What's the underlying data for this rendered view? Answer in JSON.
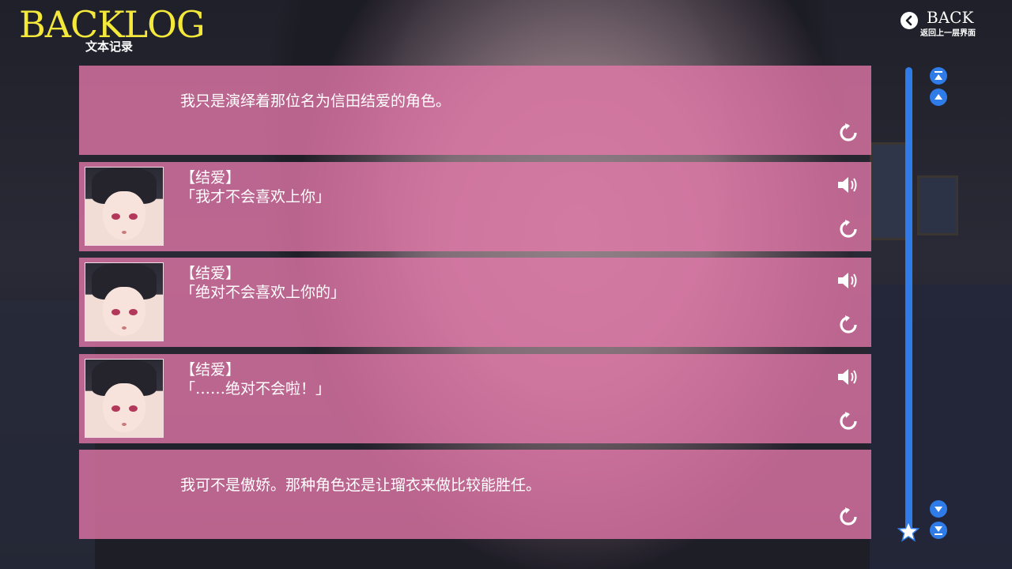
{
  "header": {
    "title": "BACKLOG",
    "subtitle": "文本记录",
    "back_label": "BACK",
    "back_sub": "返回上一层界面"
  },
  "colors": {
    "title": "#f4e93a",
    "entry_bg": "#e678aa",
    "scrollbar": "#2f7be8"
  },
  "entries": [
    {
      "type": "narration",
      "text": "我只是演绎着那位名为信田结爱的角色。",
      "has_voice": false
    },
    {
      "type": "dialogue",
      "speaker": "【结爱】",
      "text": "「我才不会喜欢上你」",
      "has_voice": true,
      "expression": "surprised"
    },
    {
      "type": "dialogue",
      "speaker": "【结爱】",
      "text": "「绝对不会喜欢上你的」",
      "has_voice": true,
      "expression": "calm"
    },
    {
      "type": "dialogue",
      "speaker": "【结爱】",
      "text": "「……绝对不会啦！」",
      "has_voice": true,
      "expression": "flustered"
    },
    {
      "type": "narration",
      "text": "我可不是傲娇。那种角色还是让瑠衣来做比较能胜任。",
      "has_voice": false
    }
  ],
  "icons": {
    "back": "chevron-left-circle-icon",
    "voice": "speaker-icon",
    "replay": "replay-icon",
    "scroll_top": "double-chevron-up-icon",
    "scroll_up": "chevron-up-icon",
    "scroll_down": "chevron-down-icon",
    "scroll_bottom": "double-chevron-down-icon",
    "scroll_thumb": "star-icon"
  }
}
